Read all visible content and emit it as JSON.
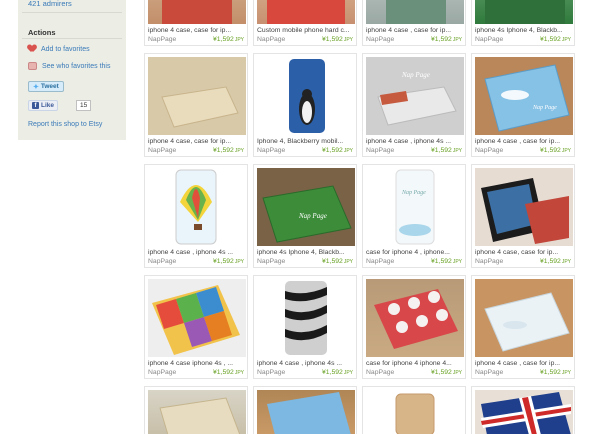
{
  "sidebar": {
    "admirers": "421 admirers",
    "actions_title": "Actions",
    "add_favorites": "Add to favorites",
    "see_who": "See who favorites this",
    "tweet": "Tweet",
    "like": "Like",
    "like_count": "15",
    "report": "Report this shop to Etsy"
  },
  "listings": [
    {
      "title": "iphone 4 case, case for ip...",
      "shop": "NapPage",
      "price": "¥1,592",
      "currency": "JPY"
    },
    {
      "title": "Custom mobile phone hard c...",
      "shop": "NapPage",
      "price": "¥1,592",
      "currency": "JPY"
    },
    {
      "title": "iphone 4 case , case for ip...",
      "shop": "NapPage",
      "price": "¥1,592",
      "currency": "JPY"
    },
    {
      "title": "iphone 4s Iphone 4, Blackb...",
      "shop": "NapPage",
      "price": "¥1,592",
      "currency": "JPY"
    },
    {
      "title": "iphone 4 case, case for ip...",
      "shop": "NapPage",
      "price": "¥1,592",
      "currency": "JPY"
    },
    {
      "title": "Iphone 4, Blackberry mobil...",
      "shop": "NapPage",
      "price": "¥1,592",
      "currency": "JPY"
    },
    {
      "title": "iphone 4 case , iphone 4s ...",
      "shop": "NapPage",
      "price": "¥1,592",
      "currency": "JPY"
    },
    {
      "title": "iphone 4 case , case for ip...",
      "shop": "NapPage",
      "price": "¥1,592",
      "currency": "JPY"
    },
    {
      "title": "iphone 4 case , iphone 4s ...",
      "shop": "NapPage",
      "price": "¥1,592",
      "currency": "JPY"
    },
    {
      "title": "iphone 4s Iphone 4, Blackb...",
      "shop": "NapPage",
      "price": "¥1,592",
      "currency": "JPY"
    },
    {
      "title": "case for iphone 4 , iphone...",
      "shop": "NapPage",
      "price": "¥1,592",
      "currency": "JPY"
    },
    {
      "title": "iphone 4 case, case for ip...",
      "shop": "NapPage",
      "price": "¥1,592",
      "currency": "JPY"
    },
    {
      "title": "iphone 4 case iphone 4s , ...",
      "shop": "NapPage",
      "price": "¥1,592",
      "currency": "JPY"
    },
    {
      "title": "iphone 4 case , iphone 4s ...",
      "shop": "NapPage",
      "price": "¥1,592",
      "currency": "JPY"
    },
    {
      "title": "case for iphone 4 iphone 4...",
      "shop": "NapPage",
      "price": "¥1,592",
      "currency": "JPY"
    },
    {
      "title": "iphone 4 case , case for ip...",
      "shop": "NapPage",
      "price": "¥1,592",
      "currency": "JPY"
    }
  ],
  "thumbnail_text": {
    "brand": "Nap Page"
  }
}
